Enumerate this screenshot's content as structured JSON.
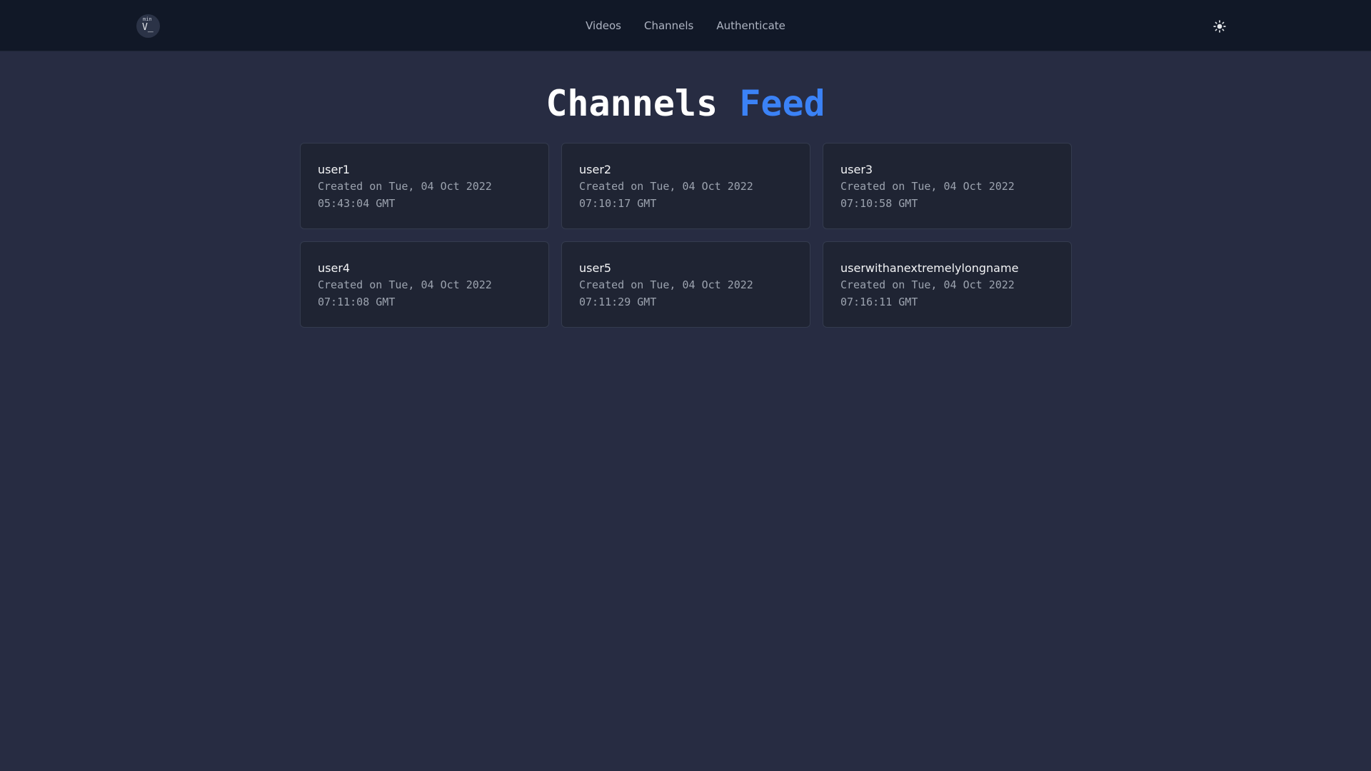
{
  "navbar": {
    "logo": {
      "superscript": "min",
      "text": "V_"
    },
    "links": [
      {
        "label": "Videos"
      },
      {
        "label": "Channels"
      },
      {
        "label": "Authenticate"
      }
    ],
    "theme_toggle_icon": "sun-icon"
  },
  "page": {
    "title_main": "Channels",
    "title_accent": "Feed"
  },
  "channels": [
    {
      "name": "user1",
      "created": "Created on Tue, 04 Oct 2022 05:43:04 GMT"
    },
    {
      "name": "user2",
      "created": "Created on Tue, 04 Oct 2022 07:10:17 GMT"
    },
    {
      "name": "user3",
      "created": "Created on Tue, 04 Oct 2022 07:10:58 GMT"
    },
    {
      "name": "user4",
      "created": "Created on Tue, 04 Oct 2022 07:11:08 GMT"
    },
    {
      "name": "user5",
      "created": "Created on Tue, 04 Oct 2022 07:11:29 GMT"
    },
    {
      "name": "userwithanextremelylongname",
      "created": "Created on Tue, 04 Oct 2022 07:16:11 GMT"
    }
  ],
  "colors": {
    "background": "#272c42",
    "navbar": "#111827",
    "card": "#1f2433",
    "accent": "#3b82f6"
  }
}
